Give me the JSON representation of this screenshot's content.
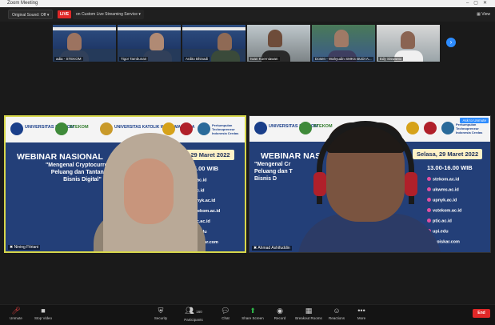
{
  "window": {
    "title": "Zoom Meeting"
  },
  "topbar": {
    "sound_chip": "Original Sound: Off",
    "live_badge": "LIVE",
    "streaming_chip": "on Custom Live Streaming Service",
    "view_label": "View"
  },
  "gallery": [
    {
      "name": "adia - STEKOM"
    },
    {
      "name": "Tigor Tambunan"
    },
    {
      "name": "Ardito Bhinadi"
    },
    {
      "name": "Iwan Koerniawan"
    },
    {
      "name": "Dosen - Wahyudin SMKS BUDI A..."
    },
    {
      "name": "Edy Siswanto"
    }
  ],
  "slide": {
    "logos": [
      "UNIVERSITAS STEKOM",
      "STEKOM",
      "UNIVERSITAS KATOLIK WIDYA MANDALA",
      "Perkumpulan Technopreneur Indonesia Cerdas"
    ],
    "title": "WEBINAR NASIONAL",
    "title_short": "WEBINAR NAS",
    "date": "Selasa, 29 Maret 2022",
    "date_partial": "a, 29 Maret 2022",
    "subtitle_lines": [
      "\"Mengenal Cryptocurrency:",
      "Peluang dan Tantangan",
      "Bisnis Digital\""
    ],
    "subtitle_partial_lines": [
      "\"Mengenal Cryptocurrency",
      "Peluang dan Tantangan",
      "Bisnis Digital\""
    ],
    "subtitle_right_lines": [
      "\"Mengenal Cr",
      "Peluang dan T",
      "Bisnis D"
    ],
    "time": "13.00-16.00 WIB",
    "time_partial": "0-16.00 WIB",
    "sites": [
      "stekom.ac.id",
      "ukwms.ac.id",
      "upnyk.ac.id",
      "vstekom.ac.id",
      "ptic.ac.id",
      "upi.edu",
      "topiskar.com"
    ],
    "sites_partial": [
      "ac.id",
      "c.id",
      "upnyk.ac.id",
      "vstekom.ac.id",
      "ptic.ac.id",
      "upi.edu",
      "topiskar.com"
    ]
  },
  "videos": {
    "left_name": "Nining Fitriani",
    "right_name": "Ahmad Ashifuddin",
    "ask_unmute": "Ask to Unmute"
  },
  "toolbar": {
    "unmute": "Unmute",
    "stop_video": "Stop Video",
    "security": "Security",
    "participants": "Participants",
    "participants_count": "160",
    "chat": "Chat",
    "share_screen": "Share Screen",
    "record": "Record",
    "breakout_rooms": "Breakout Rooms",
    "reactions": "Reactions",
    "more": "More",
    "end": "End"
  }
}
